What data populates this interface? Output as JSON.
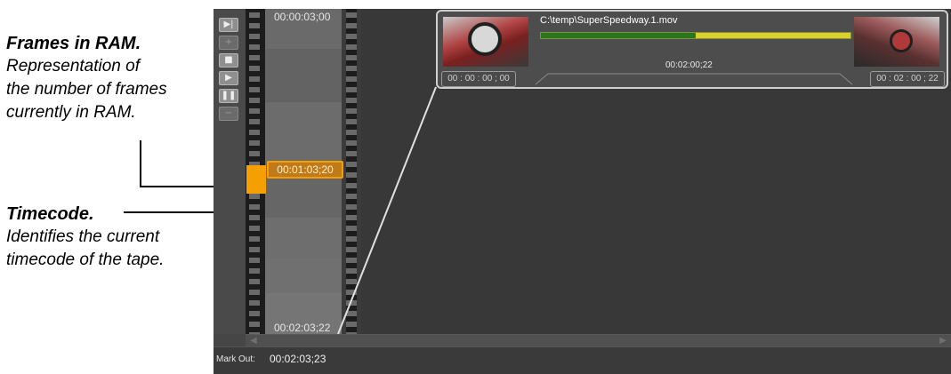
{
  "annotations": {
    "frames_in_ram": {
      "heading": "Frames in RAM.",
      "lines": [
        "Representation of",
        "the number of frames",
        "currently in RAM."
      ]
    },
    "timecode": {
      "heading": "Timecode.",
      "lines": [
        "Identifies the current",
        "timecode of the tape."
      ]
    }
  },
  "film_strip": {
    "top_timecode": "00:00:03;00",
    "current_timecode": "00:01:03;20",
    "bottom_timecode": "00:02:03;22"
  },
  "clip": {
    "path": "C:\\temp\\SuperSpeedway.1.mov",
    "duration": "00:02:00;22",
    "in_timecode": "00 : 00 : 00 ; 00",
    "out_timecode": "00 : 02 : 00 ; 22",
    "progress_fraction": 0.5
  },
  "status": {
    "label": "Mark Out:",
    "value": "00:02:03;23"
  },
  "colors": {
    "marker": "#f5a000",
    "progress_done": "#257a1f",
    "progress_remaining": "#d9d229"
  },
  "toolbar": {
    "icons": [
      "step-forward-icon",
      "plus-icon",
      "stop-icon",
      "play-icon",
      "pause-icon",
      "minus-icon"
    ]
  }
}
